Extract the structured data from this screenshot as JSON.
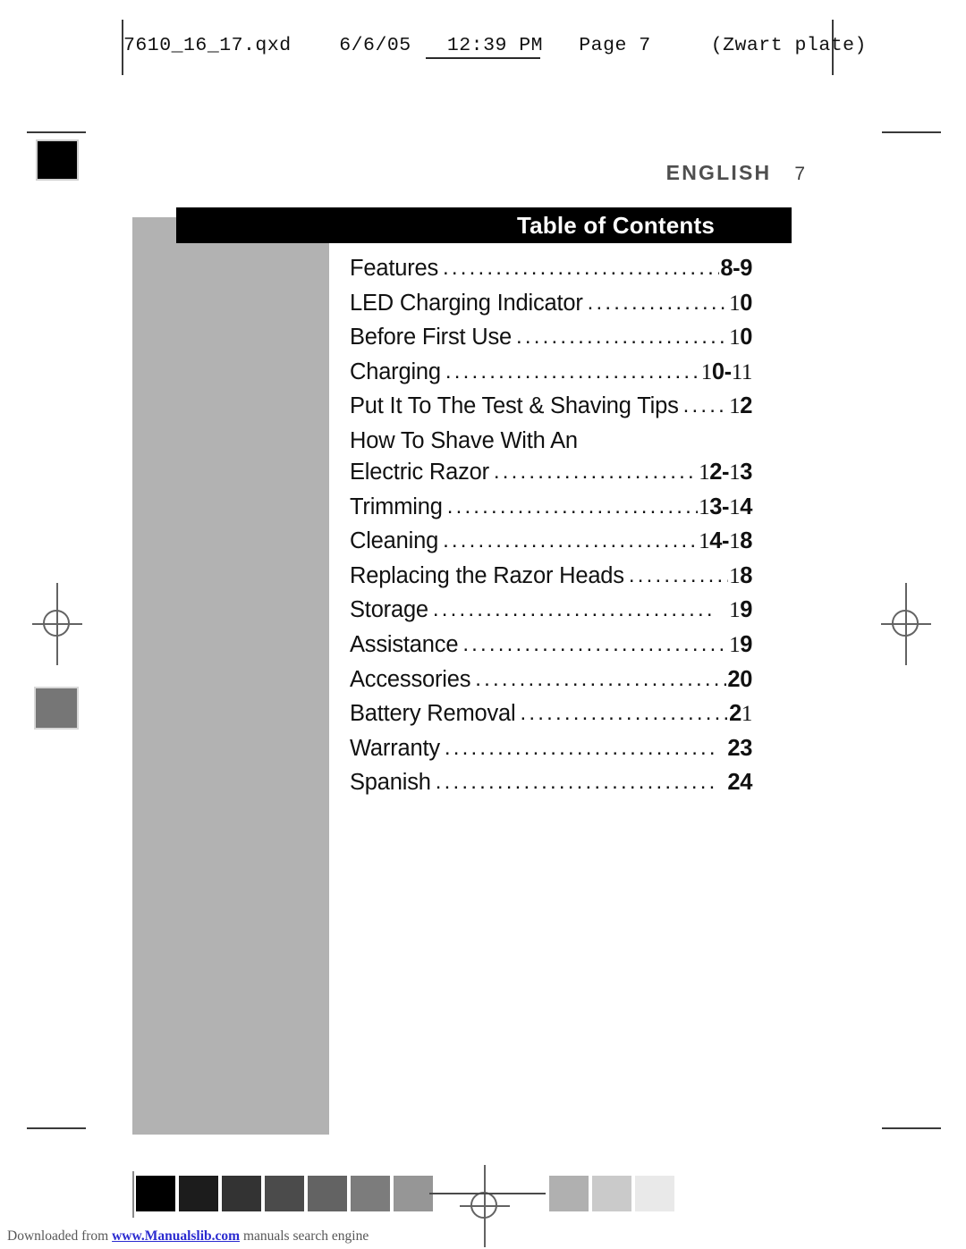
{
  "slug": {
    "text": "7610_16_17.qxd    6/6/05   12:39 PM   Page 7     (Zwart plate)"
  },
  "running_head": {
    "language": "ENGLISH",
    "page_number": "7"
  },
  "title_bar": {
    "title": "Table of Contents"
  },
  "toc": {
    "entries": [
      {
        "label": "Features",
        "page": "8-9",
        "dots": "................................."
      },
      {
        "label": "LED Charging Indicator",
        "page": "10",
        "dots": "..................."
      },
      {
        "label": "Before First Use",
        "page": "10",
        "dots": "..........................."
      },
      {
        "label": "Charging",
        "page": "10-11",
        "dots": "..............................."
      },
      {
        "label": "Put It To The Test & Shaving Tips",
        "page": "12",
        "dots": "........."
      },
      {
        "label": "How To Shave With An",
        "page": "",
        "dots": ""
      },
      {
        "label": "Electric Razor",
        "page": "12-13",
        "dots": "..........................."
      },
      {
        "label": "Trimming",
        "page": "13-14",
        "dots": "..............................."
      },
      {
        "label": "Cleaning",
        "page": "14-18",
        "dots": "..............................."
      },
      {
        "label": "Replacing the Razor Heads",
        "page": "18",
        "dots": "..............."
      },
      {
        "label": "Storage",
        "page": "19",
        "dots": "................................"
      },
      {
        "label": "Assistance",
        "page": "19",
        "dots": ".............................."
      },
      {
        "label": "Accessories",
        "page": "20",
        "dots": "............................."
      },
      {
        "label": "Battery Removal",
        "page": "21",
        "dots": "........................."
      },
      {
        "label": "Warranty",
        "page": "23",
        "dots": "..............................."
      },
      {
        "label": "Spanish",
        "page": "24",
        "dots": "................................"
      }
    ]
  },
  "calibration": {
    "left_swatches": [
      "#000000",
      "#1c1c1c",
      "#333333",
      "#4b4b4b",
      "#636363",
      "#7c7c7c",
      "#969696"
    ],
    "right_swatches": [
      "#b0b0b0",
      "#cacaca",
      "#e9e9e9"
    ]
  },
  "footer": {
    "prefix": "Downloaded from ",
    "link": "www.Manualslib.com",
    "suffix": " manuals search engine"
  },
  "colors": {
    "title_bar_bg": "#000000",
    "grey_block": "#b2b2b2",
    "running_head": "#4f4f4f",
    "link": "#2b2bd0"
  }
}
